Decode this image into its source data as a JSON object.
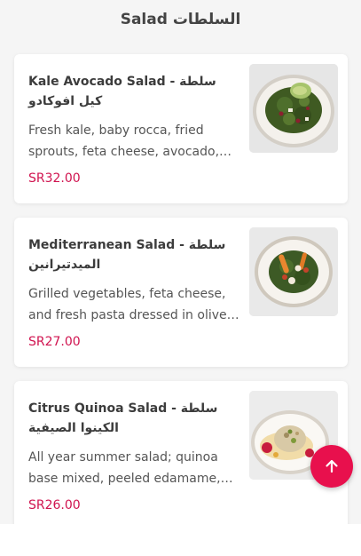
{
  "section": {
    "title": "Salad السلطات"
  },
  "items": [
    {
      "title": "Kale Avocado Salad - سلطة كيل افوكادو",
      "description": "Fresh kale, baby rocca, fried sprouts, feta cheese, avocado, pomegranate and walnuts",
      "price": "SR32.00",
      "image_icon": "kale-avocado-salad-photo"
    },
    {
      "title": "Mediterranean Salad - سلطة الميدتيرانين",
      "description": "Grilled vegetables, feta cheese, and fresh pasta dressed in olive oil",
      "price": "SR27.00",
      "image_icon": "mediterranean-salad-photo"
    },
    {
      "title": "Citrus Quinoa Salad - سلطة الكينوا الصيفية",
      "description": "All year summer salad; quinoa base mixed, peeled edamame, citrus and herbs",
      "price": "SR26.00",
      "image_icon": "citrus-quinoa-salad-photo"
    }
  ],
  "scroll_top": {
    "icon": "arrow-up-icon",
    "color": "#e8104d"
  },
  "colors": {
    "price": "#d0134f",
    "background": "#f5f5f5"
  }
}
